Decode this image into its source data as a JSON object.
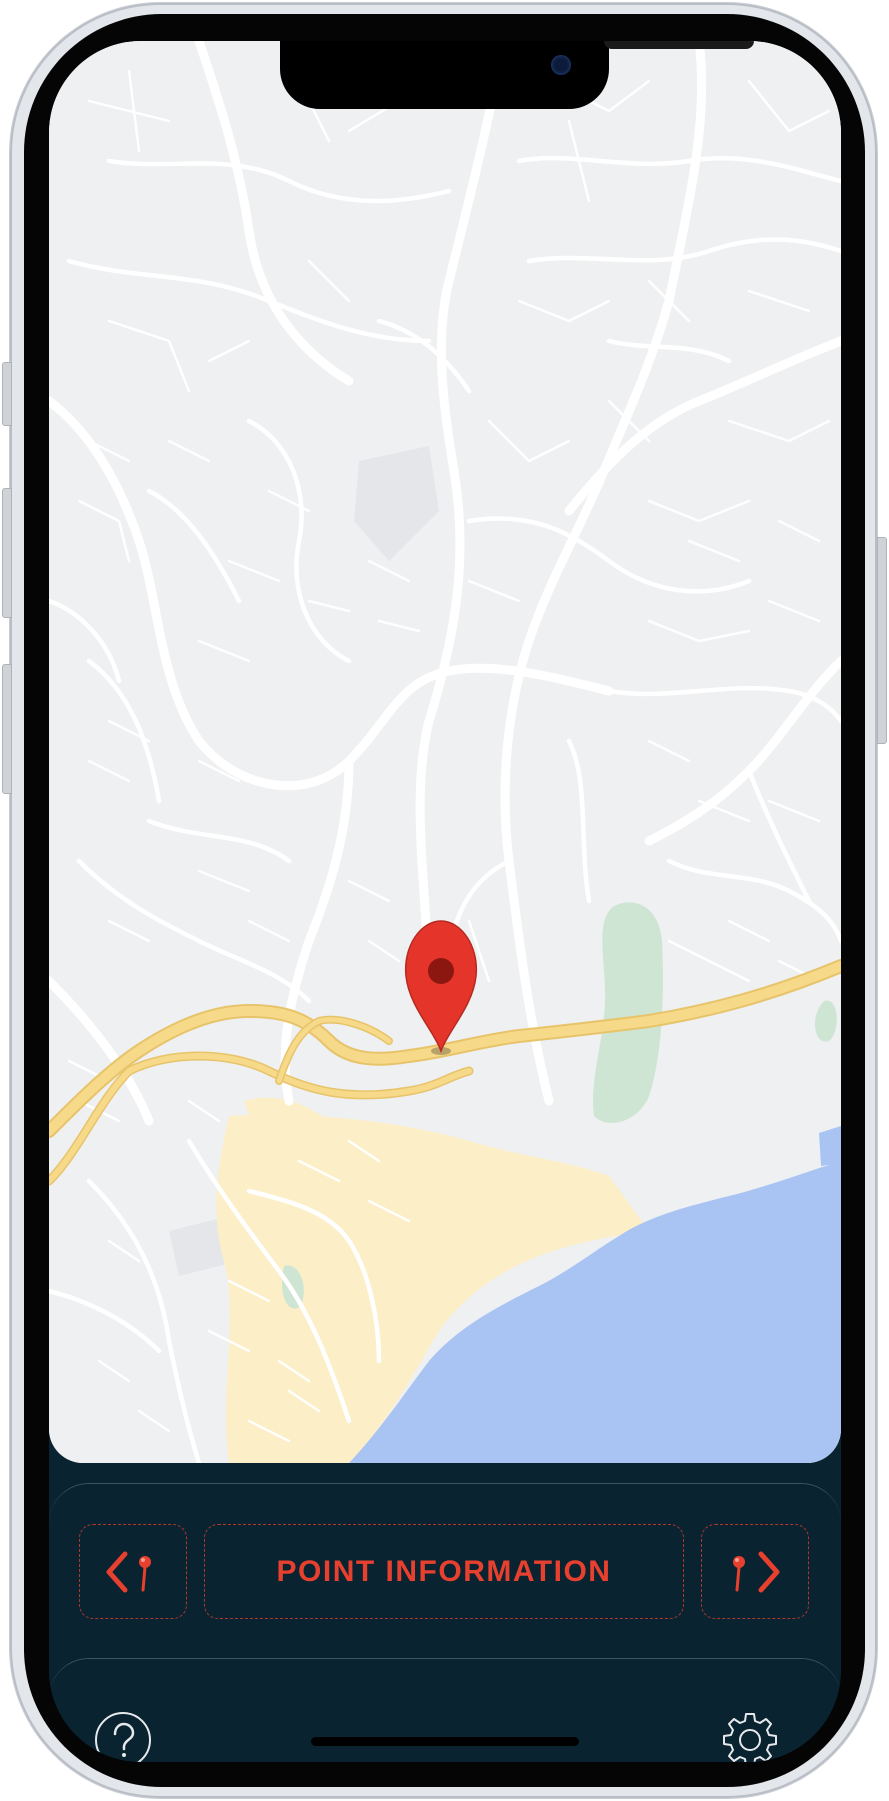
{
  "app": {
    "accent_color": "#e8402f",
    "panel_color": "#0a2330",
    "map": {
      "pin_icon": "map-pin-icon",
      "water_color": "#a9c4f3",
      "park_color": "#cfe5d3",
      "highway_color": "#f7d98a",
      "land_color": "#eff0f2"
    },
    "controls": {
      "prev_icon": "previous-point-icon",
      "info_label": "POINT INFORMATION",
      "next_icon": "next-point-icon"
    },
    "footer": {
      "help_icon": "help-icon",
      "settings_icon": "gear-icon"
    }
  }
}
